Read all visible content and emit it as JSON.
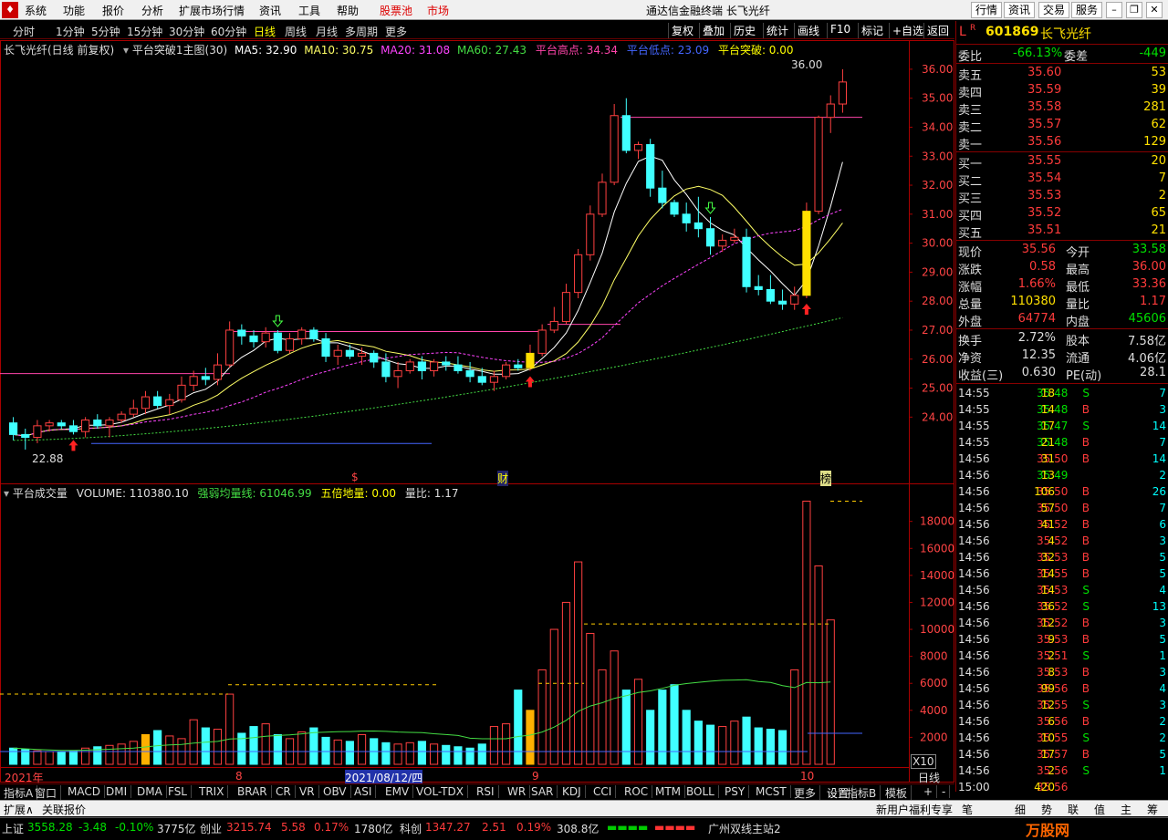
{
  "menubar": {
    "items": [
      "系统",
      "功能",
      "报价",
      "分析",
      "扩展市场行情",
      "资讯",
      "工具",
      "帮助"
    ],
    "stock_pool": "股票池",
    "market": "市场",
    "title": "通达信金融终端  长飞光纤",
    "right_buttons": [
      "行情",
      "资讯",
      "交易",
      "服务"
    ]
  },
  "periods": {
    "items": [
      "分时",
      "1分钟",
      "5分钟",
      "15分钟",
      "30分钟",
      "60分钟",
      "日线",
      "周线",
      "月线",
      "多周期",
      "更多"
    ],
    "active": "日线",
    "tools": [
      "复权",
      "叠加",
      "历史",
      "统计",
      "画线",
      "F10",
      "标记",
      "+自选",
      "返回"
    ]
  },
  "main_header": {
    "name": "长飞光纤(日线 前复权)",
    "formula": "平台突破1主图(30)",
    "ma5": "MA5: 32.90",
    "ma10": "MA10: 30.75",
    "ma20": "MA20: 31.08",
    "ma60": "MA60: 27.43",
    "high": "平台高点: 34.34",
    "low": "平台低点: 23.09",
    "brk": "平台突破: 0.00"
  },
  "vol_header": {
    "name": "平台成交量",
    "vol": "VOLUME: 110380.10",
    "strong": "强弱均量线: 61046.99",
    "five": "五倍地量: 0.00",
    "ratio": "量比: 1.17"
  },
  "annotations": {
    "hi": "36.00",
    "lo": "22.88",
    "m1": "$",
    "m2": "财",
    "m3": "榜",
    "x10": "X10",
    "date_tag": "2021/08/12/四"
  },
  "xaxis": {
    "labels": [
      "2021年",
      "8",
      "9",
      "10"
    ],
    "right": "日线"
  },
  "colors": {
    "up": "#ff4040",
    "down": "#40ffff",
    "ma5": "#ffffff",
    "ma10": "#ffff66",
    "ma20": "#ff44ff",
    "ma60": "#44dd44",
    "platform_high": "#ff44aa",
    "platform_low": "#4466ff"
  },
  "chart_data": {
    "type": "candlestick",
    "ohlc": [
      [
        23.8,
        24.0,
        23.2,
        23.4
      ],
      [
        23.4,
        23.6,
        22.88,
        23.3
      ],
      [
        23.3,
        23.9,
        23.1,
        23.7
      ],
      [
        23.7,
        23.9,
        23.5,
        23.8
      ],
      [
        23.8,
        23.9,
        23.6,
        23.7
      ],
      [
        23.7,
        23.9,
        23.4,
        23.5
      ],
      [
        23.5,
        24.0,
        23.3,
        23.9
      ],
      [
        23.9,
        24.1,
        23.6,
        23.7
      ],
      [
        23.7,
        24.0,
        23.3,
        23.9
      ],
      [
        23.9,
        24.2,
        23.8,
        24.1
      ],
      [
        24.1,
        24.6,
        24.0,
        24.3
      ],
      [
        24.3,
        24.9,
        24.1,
        24.7
      ],
      [
        24.7,
        24.9,
        24.3,
        24.4
      ],
      [
        24.4,
        24.8,
        24.1,
        24.6
      ],
      [
        24.6,
        25.4,
        24.5,
        25.1
      ],
      [
        25.1,
        25.6,
        24.9,
        25.4
      ],
      [
        25.4,
        25.7,
        25.1,
        25.3
      ],
      [
        25.3,
        26.2,
        25.1,
        25.8
      ],
      [
        25.8,
        27.3,
        25.7,
        27.0
      ],
      [
        27.0,
        27.2,
        26.5,
        26.8
      ],
      [
        26.8,
        27.0,
        26.4,
        26.6
      ],
      [
        26.6,
        27.1,
        26.4,
        26.9
      ],
      [
        26.9,
        27.0,
        26.2,
        26.3
      ],
      [
        26.3,
        26.9,
        26.2,
        26.7
      ],
      [
        26.7,
        27.1,
        26.5,
        27.0
      ],
      [
        27.0,
        27.1,
        26.6,
        26.7
      ],
      [
        26.7,
        26.9,
        25.9,
        26.1
      ],
      [
        26.1,
        26.5,
        25.8,
        26.3
      ],
      [
        26.3,
        26.5,
        26.0,
        26.1
      ],
      [
        26.1,
        26.4,
        25.8,
        26.2
      ],
      [
        26.2,
        26.3,
        25.7,
        25.9
      ],
      [
        25.9,
        26.2,
        25.2,
        25.4
      ],
      [
        25.4,
        25.9,
        25.0,
        25.6
      ],
      [
        25.6,
        26.0,
        25.5,
        25.9
      ],
      [
        25.9,
        26.1,
        25.3,
        25.6
      ],
      [
        25.6,
        26.0,
        25.4,
        25.9
      ],
      [
        25.9,
        26.1,
        25.6,
        25.8
      ],
      [
        25.8,
        26.1,
        25.5,
        25.6
      ],
      [
        25.6,
        25.9,
        25.2,
        25.4
      ],
      [
        25.4,
        25.7,
        25.1,
        25.2
      ],
      [
        25.2,
        25.6,
        24.9,
        25.4
      ],
      [
        25.4,
        25.9,
        25.3,
        25.8
      ],
      [
        25.8,
        26.0,
        25.6,
        25.7
      ],
      [
        25.7,
        26.5,
        25.6,
        26.2
      ],
      [
        26.2,
        27.2,
        26.1,
        27.0
      ],
      [
        27.0,
        27.8,
        26.9,
        27.3
      ],
      [
        27.3,
        28.6,
        27.2,
        28.3
      ],
      [
        28.3,
        29.8,
        28.1,
        29.6
      ],
      [
        29.6,
        31.3,
        29.4,
        31.0
      ],
      [
        31.0,
        32.4,
        30.9,
        32.1
      ],
      [
        32.1,
        34.8,
        32.0,
        34.4
      ],
      [
        34.4,
        35.0,
        33.1,
        33.2
      ],
      [
        33.2,
        33.5,
        32.9,
        33.4
      ],
      [
        33.4,
        33.6,
        31.6,
        31.9
      ],
      [
        31.9,
        32.5,
        31.2,
        31.4
      ],
      [
        31.4,
        31.5,
        30.9,
        31.0
      ],
      [
        31.0,
        31.4,
        30.4,
        30.7
      ],
      [
        30.7,
        31.6,
        30.2,
        30.5
      ],
      [
        30.5,
        30.9,
        29.6,
        29.9
      ],
      [
        29.9,
        30.3,
        29.7,
        30.1
      ],
      [
        30.1,
        30.5,
        30.0,
        30.2
      ],
      [
        30.2,
        30.5,
        28.3,
        28.5
      ],
      [
        28.5,
        28.9,
        28.2,
        28.4
      ],
      [
        28.4,
        28.9,
        27.9,
        28.0
      ],
      [
        28.0,
        28.4,
        27.7,
        27.9
      ],
      [
        27.9,
        28.5,
        27.7,
        28.2
      ],
      [
        28.2,
        31.4,
        28.1,
        31.1
      ],
      [
        31.1,
        34.4,
        31.0,
        34.34
      ],
      [
        34.34,
        35.1,
        33.8,
        34.8
      ],
      [
        34.8,
        36.0,
        34.5,
        35.56
      ]
    ],
    "volume": [
      1200,
      1100,
      1000,
      950,
      900,
      1000,
      1200,
      1300,
      1400,
      1500,
      1700,
      2200,
      2500,
      2100,
      1900,
      3300,
      2700,
      2600,
      5200,
      2300,
      2800,
      3000,
      2200,
      1900,
      2400,
      2700,
      2000,
      1800,
      1700,
      2200,
      1900,
      1600,
      1500,
      1600,
      1700,
      1500,
      1400,
      1300,
      1200,
      1500,
      2800,
      3000,
      5500,
      4000,
      7000,
      10000,
      12000,
      15000,
      9700,
      7000,
      8400,
      5500,
      6300,
      4000,
      5500,
      5900,
      4000,
      3200,
      2900,
      2800,
      3200,
      3500,
      2700,
      2600,
      2500,
      7000,
      19500,
      14700,
      10700
    ],
    "ma": {
      "ma5_last": 32.9,
      "ma10_last": 30.75,
      "ma20_last": 31.08,
      "ma60_last": 27.43
    },
    "platform": {
      "high": 34.34,
      "low": 23.09
    },
    "ylim": [
      22.5,
      36.5
    ],
    "vol_ylim": [
      0,
      19600
    ],
    "yticks": [
      24.0,
      25.0,
      26.0,
      27.0,
      28.0,
      29.0,
      30.0,
      31.0,
      32.0,
      33.0,
      34.0,
      35.0,
      36.0
    ],
    "vol_yticks": [
      2000,
      4000,
      6000,
      8000,
      10000,
      12000,
      14000,
      16000,
      18000
    ]
  },
  "quote": {
    "code": "601869",
    "name": "长飞光纤",
    "wb_label": "委比",
    "wb": "-66.13%",
    "wc_label": "委差",
    "wc": "-449",
    "sell": [
      [
        "卖五",
        "35.60",
        "53"
      ],
      [
        "卖四",
        "35.59",
        "39"
      ],
      [
        "卖三",
        "35.58",
        "281"
      ],
      [
        "卖二",
        "35.57",
        "62"
      ],
      [
        "卖一",
        "35.56",
        "129"
      ]
    ],
    "buy": [
      [
        "买一",
        "35.55",
        "20"
      ],
      [
        "买二",
        "35.54",
        "7"
      ],
      [
        "买三",
        "35.53",
        "2"
      ],
      [
        "买四",
        "35.52",
        "65"
      ],
      [
        "买五",
        "35.51",
        "21"
      ]
    ],
    "stats": [
      [
        "现价",
        "35.56",
        "今开",
        "33.58"
      ],
      [
        "涨跌",
        "0.58",
        "最高",
        "36.00"
      ],
      [
        "涨幅",
        "1.66%",
        "最低",
        "33.36"
      ],
      [
        "总量",
        "110380",
        "量比",
        "1.17"
      ],
      [
        "外盘",
        "64774",
        "内盘",
        "45606"
      ]
    ],
    "stats2": [
      [
        "换手",
        "2.72%",
        "股本",
        "7.58亿"
      ],
      [
        "净资",
        "12.35",
        "流通",
        "4.06亿"
      ],
      [
        "收益(三)",
        "0.630",
        "PE(动)",
        "28.1"
      ]
    ]
  },
  "ticks": [
    [
      "14:55",
      "35.48",
      "18",
      "S",
      "7"
    ],
    [
      "14:55",
      "35.48",
      "14",
      "B",
      "3"
    ],
    [
      "14:55",
      "35.47",
      "17",
      "S",
      "14"
    ],
    [
      "14:55",
      "35.48",
      "21",
      "B",
      "7"
    ],
    [
      "14:56",
      "35.50",
      "31",
      "B",
      "14"
    ],
    [
      "14:56",
      "35.49",
      "13",
      "",
      "2"
    ],
    [
      "14:56",
      "35.50",
      "106",
      "B",
      "26"
    ],
    [
      "14:56",
      "35.50",
      "57",
      "B",
      "7"
    ],
    [
      "14:56",
      "35.52",
      "41",
      "B",
      "6"
    ],
    [
      "14:56",
      "35.52",
      "4",
      "B",
      "3"
    ],
    [
      "14:56",
      "35.53",
      "32",
      "B",
      "5"
    ],
    [
      "14:56",
      "35.55",
      "14",
      "B",
      "5"
    ],
    [
      "14:56",
      "35.53",
      "14",
      "S",
      "4"
    ],
    [
      "14:56",
      "35.52",
      "36",
      "S",
      "13"
    ],
    [
      "14:56",
      "35.52",
      "12",
      "B",
      "3"
    ],
    [
      "14:56",
      "35.53",
      "9",
      "B",
      "5"
    ],
    [
      "14:56",
      "35.51",
      "2",
      "S",
      "1"
    ],
    [
      "14:56",
      "35.53",
      "8",
      "B",
      "3"
    ],
    [
      "14:56",
      "35.56",
      "99",
      "B",
      "4"
    ],
    [
      "14:56",
      "35.55",
      "12",
      "S",
      "3"
    ],
    [
      "14:56",
      "35.56",
      "6",
      "B",
      "2"
    ],
    [
      "14:56",
      "35.55",
      "10",
      "S",
      "2"
    ],
    [
      "14:56",
      "35.57",
      "17",
      "B",
      "5"
    ],
    [
      "14:56",
      "35.56",
      "2",
      "S",
      "1"
    ],
    [
      "15:00",
      "35.56",
      "420",
      "",
      ""
    ]
  ],
  "bottom_tabs": [
    "指标A",
    "窗口",
    "MACD",
    "DMI",
    "DMA",
    "FSL",
    "TRIX",
    "BRAR",
    "CR",
    "VR",
    "OBV",
    "ASI",
    "EMV",
    "VOL-TDX",
    "RSI",
    "WR",
    "SAR",
    "KDJ",
    "CCI",
    "ROC",
    "MTM",
    "BOLL",
    "PSY",
    "MCST",
    "更多",
    "设置"
  ],
  "bottom_right": [
    "指标B",
    "模板",
    "+",
    "-"
  ],
  "ext": {
    "left": [
      "扩展∧",
      "关联报价"
    ],
    "right": "新用户福利专享",
    "side": [
      "笔",
      "细",
      "势",
      "联",
      "值",
      "主",
      "筹"
    ]
  },
  "status": {
    "sh_label": "上证",
    "sh": "3558.28",
    "sh_chg": "-3.48",
    "sh_pct": "-0.10%",
    "sh_amt": "3775亿",
    "cy_label": "创业",
    "cy": "3215.74",
    "cy_chg": "5.58",
    "cy_pct": "0.17%",
    "cy_amt": "1780亿",
    "kc_label": "科创",
    "kc": "1347.27",
    "kc_chg": "2.51",
    "kc_pct": "0.19%",
    "kc_amt": "308.8亿",
    "server": "广州双线主站2",
    "brand": "万股网"
  }
}
